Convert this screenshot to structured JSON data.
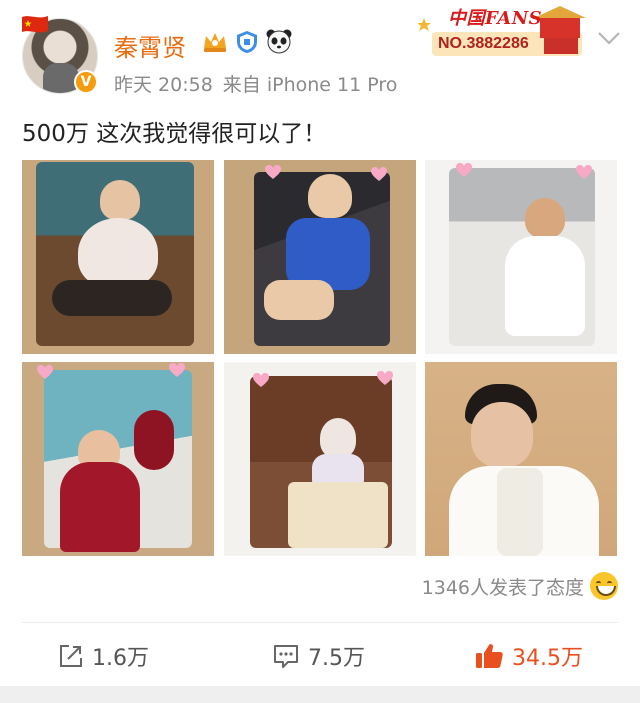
{
  "user": {
    "name": "秦霄贤",
    "badge_icons": [
      "crown-badge-icon",
      "shield-badge-icon",
      "panda-badge-icon"
    ],
    "verified_icon": "verified-v-icon",
    "avatar_flag_icon": "china-flag-icon"
  },
  "meta": {
    "time": "昨天 20:58",
    "source": "来自 iPhone 11 Pro"
  },
  "fans_banner": {
    "title": "中国FANS",
    "number": "NO.3882286"
  },
  "post": {
    "text": "500万 这次我觉得很可以了！"
  },
  "photos": [
    {
      "subject": "toddler-sitting-crying"
    },
    {
      "subject": "child-in-blue-shirt-crouching"
    },
    {
      "subject": "toddler-in-white-cloth"
    },
    {
      "subject": "toddler-in-red-with-mirror"
    },
    {
      "subject": "child-with-veil-and-quilt"
    },
    {
      "subject": "young-man-in-white-jacket"
    }
  ],
  "reactions": {
    "text": "1346人发表了态度",
    "icon": "grin-emoji-icon"
  },
  "actions": {
    "share_count": "1.6万",
    "comment_count": "7.5万",
    "like_count": "34.5万"
  },
  "colors": {
    "username": "#e86b10",
    "like": "#e8501f",
    "verified": "#f59b0c",
    "fans_red": "#d91a1a"
  }
}
